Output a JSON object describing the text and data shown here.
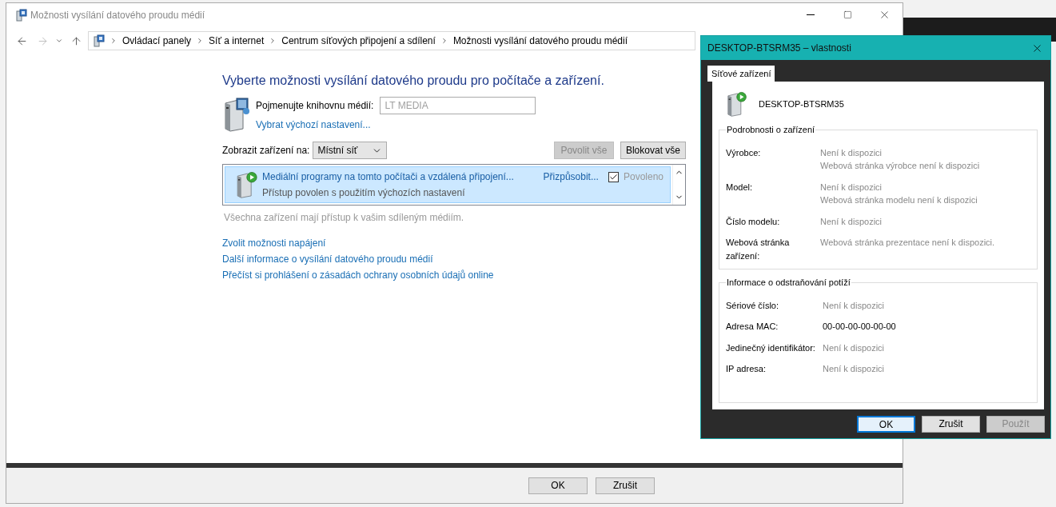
{
  "window": {
    "title": "Možnosti vysílání datového proudu médií"
  },
  "breadcrumb": [
    "Ovládací panely",
    "Síť a internet",
    "Centrum síťových připojení a sdílení",
    "Možnosti vysílání datového proudu médií"
  ],
  "heading": "Vyberte možnosti vysílání datového proudu pro počítače a zařízení.",
  "library": {
    "label": "Pojmenujte knihovnu médií:",
    "value": "LT MEDIA",
    "disabled": true,
    "link": "Vybrat výchozí nastavení..."
  },
  "show_on": {
    "label": "Zobrazit zařízení na:",
    "value": "Místní síť"
  },
  "list_buttons": [
    {
      "label": "Povolit vše",
      "disabled": true
    },
    {
      "label": "Blokovat vše",
      "disabled": false
    }
  ],
  "devices": [
    {
      "name": "Mediální programy na tomto počítači a vzdálená připojení...",
      "status": "Přístup povolen s použitím výchozích nastavení",
      "customize": "Přizpůsobit...",
      "allowed_label": "Povoleno",
      "checked": true,
      "selected": true
    }
  ],
  "note": "Všechna zařízení mají přístup k vašim sdíleným médiím.",
  "links": [
    "Zvolit možnosti napájení",
    "Další informace o vysílání datového proudu médií",
    "Přečíst si prohlášení o zásadách ochrany osobních údajů online"
  ],
  "footer_buttons": [
    "OK",
    "Zrušit"
  ],
  "dialog": {
    "title": "DESKTOP-BTSRM35 – vlastnosti",
    "tabs": [
      {
        "label": "Síťové zařízení",
        "selected": true
      }
    ],
    "device_name": "DESKTOP-BTSRM35",
    "groups": [
      {
        "title": "Podrobnosti o zařízení",
        "rows": [
          {
            "label": "Výrobce:",
            "values": [
              "Není k dispozici",
              "Webová stránka výrobce není k dispozici"
            ],
            "dimmed": true
          },
          {
            "label": "Model:",
            "values": [
              "Není k dispozici",
              "Webová stránka modelu není k dispozici"
            ],
            "dimmed": true
          },
          {
            "label": "Číslo modelu:",
            "values": [
              "Není k dispozici"
            ],
            "dimmed": true
          },
          {
            "label": "Webová stránka zařízení:",
            "values": [
              "Webová stránka prezentace není k dispozici."
            ],
            "dimmed": true
          }
        ]
      },
      {
        "title": "Informace o odstraňování potíží",
        "rows": [
          {
            "label": "Sériové číslo:",
            "values": [
              "Není k dispozici"
            ],
            "dimmed": true
          },
          {
            "label": "Adresa MAC:",
            "values": [
              "00-00-00-00-00-00"
            ],
            "dimmed": false
          },
          {
            "label": "Jedinečný identifikátor:",
            "values": [
              "Není k dispozici"
            ],
            "dimmed": true
          },
          {
            "label": "IP adresa:",
            "values": [
              "Není k dispozici"
            ],
            "dimmed": true
          }
        ]
      }
    ],
    "buttons": [
      {
        "label": "OK",
        "default": true,
        "disabled": false
      },
      {
        "label": "Zrušit",
        "default": false,
        "disabled": false
      },
      {
        "label": "Použít",
        "default": false,
        "disabled": true
      }
    ]
  }
}
